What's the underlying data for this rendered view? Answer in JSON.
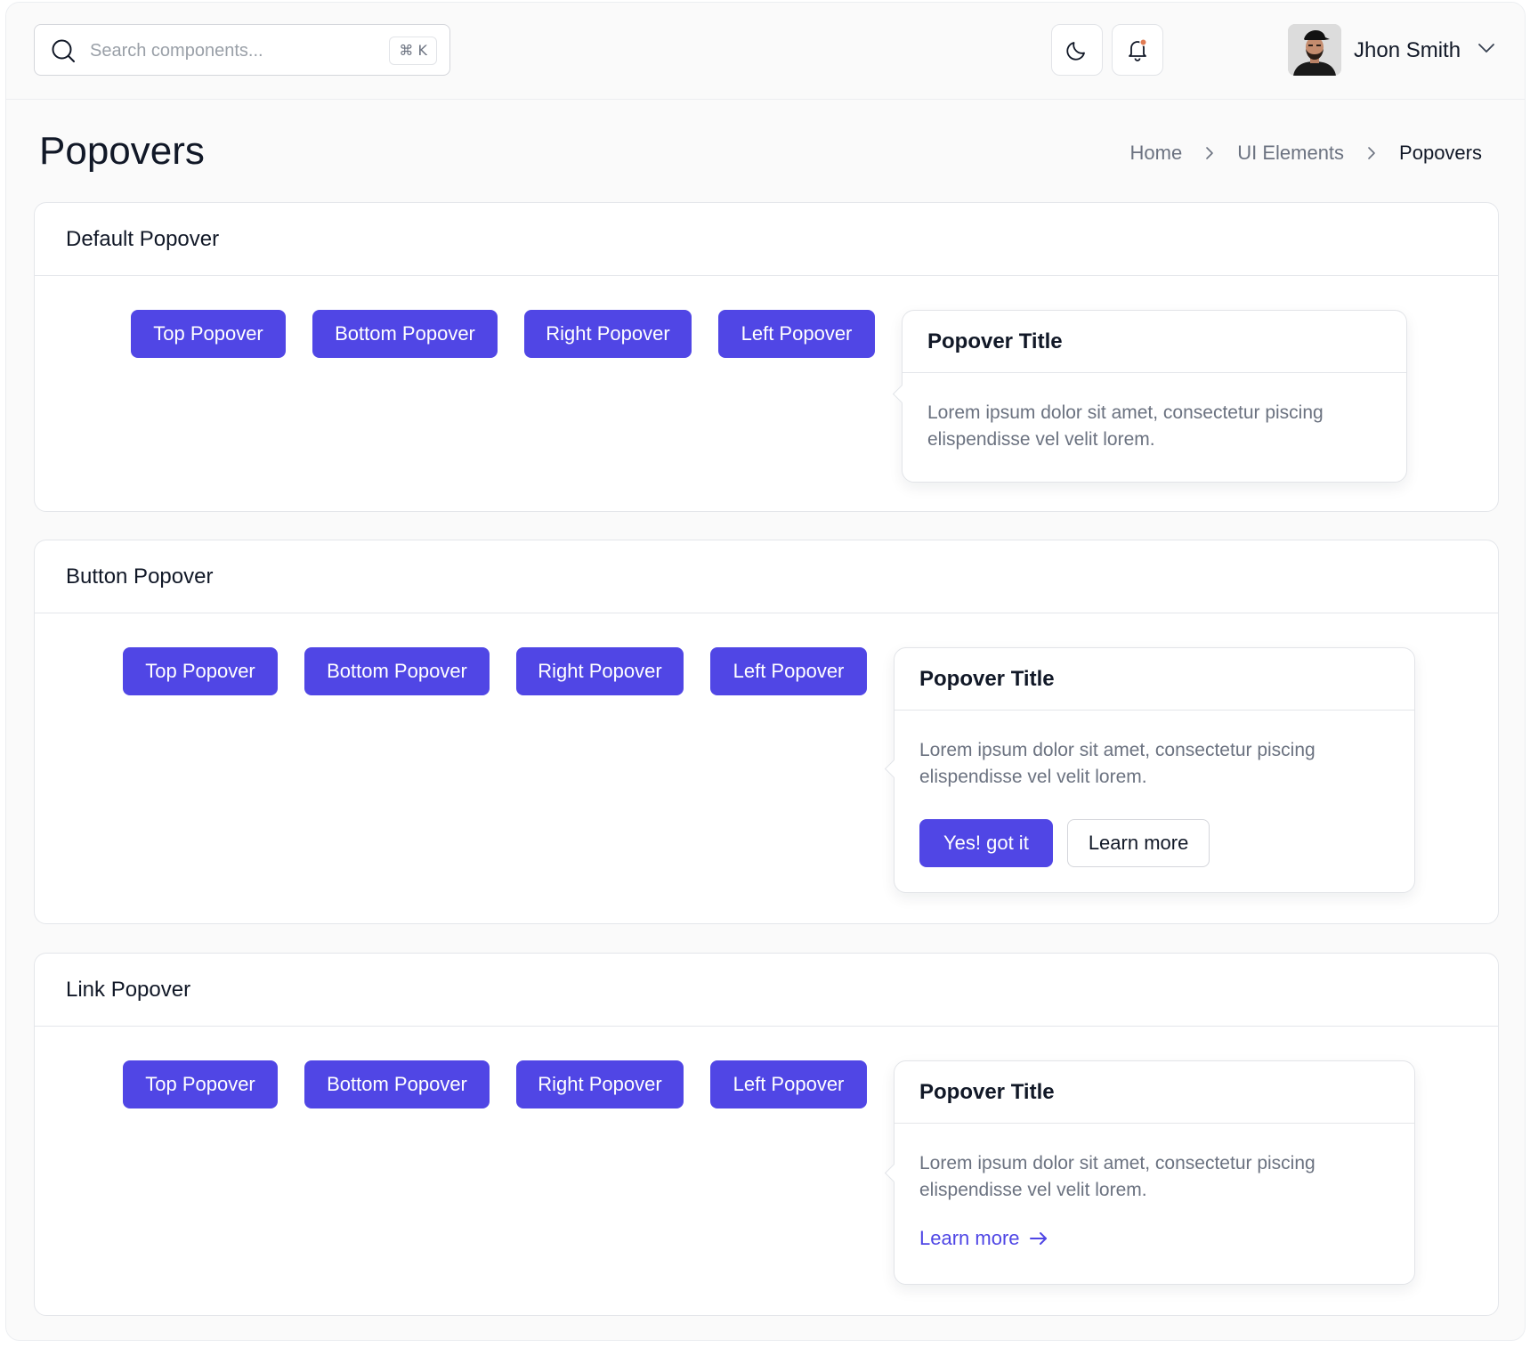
{
  "header": {
    "search_placeholder": "Search components...",
    "search_shortcut": "⌘ K",
    "user_name": "Jhon Smith",
    "notification_dot_color": "#e07b53"
  },
  "page": {
    "title": "Popovers",
    "breadcrumb": [
      "Home",
      "UI Elements",
      "Popovers"
    ]
  },
  "colors": {
    "primary": "#5046e5",
    "link": "#4f46e5"
  },
  "sections": [
    {
      "title": "Default Popover",
      "buttons": [
        "Top Popover",
        "Bottom Popover",
        "Right Popover",
        "Left Popover"
      ],
      "popover": {
        "title": "Popover Title",
        "body_line1": "Lorem ipsum dolor sit amet, consectetur piscing",
        "body_line2": "elispendisse vel velit lorem."
      }
    },
    {
      "title": "Button Popover",
      "buttons": [
        "Top Popover",
        "Bottom Popover",
        "Right Popover",
        "Left Popover"
      ],
      "popover": {
        "title": "Popover Title",
        "body_line1": "Lorem ipsum dolor sit amet, consectetur piscing",
        "body_line2": "elispendisse vel velit lorem.",
        "primary_action": "Yes! got it",
        "secondary_action": "Learn more"
      }
    },
    {
      "title": "Link Popover",
      "buttons": [
        "Top Popover",
        "Bottom Popover",
        "Right Popover",
        "Left Popover"
      ],
      "popover": {
        "title": "Popover Title",
        "body_line1": "Lorem ipsum dolor sit amet, consectetur piscing",
        "body_line2": "elispendisse vel velit lorem.",
        "link": "Learn more"
      }
    }
  ]
}
